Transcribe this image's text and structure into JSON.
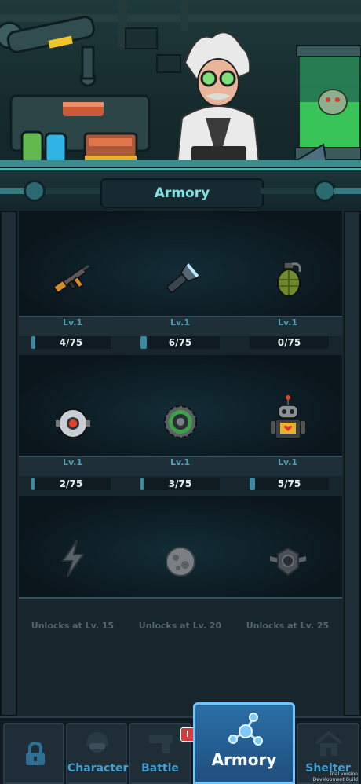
{
  "title": "Armory",
  "shelves": [
    {
      "items": [
        {
          "icon": "rifle-icon",
          "level": "Lv.1",
          "progress": "4/75",
          "fill": 0.05
        },
        {
          "icon": "flashlight-icon",
          "level": "Lv.1",
          "progress": "6/75",
          "fill": 0.08
        },
        {
          "icon": "grenade-icon",
          "level": "Lv.1",
          "progress": "0/75",
          "fill": 0
        }
      ]
    },
    {
      "items": [
        {
          "icon": "drone-orb-icon",
          "level": "Lv.1",
          "progress": "2/75",
          "fill": 0.03
        },
        {
          "icon": "sawblade-icon",
          "level": "Lv.1",
          "progress": "3/75",
          "fill": 0.04
        },
        {
          "icon": "robot-icon",
          "level": "Lv.1",
          "progress": "5/75",
          "fill": 0.07
        }
      ]
    },
    {
      "items": [
        {
          "icon": "lightning-icon",
          "unlock": "Unlocks at Lv. 15"
        },
        {
          "icon": "asteroid-icon",
          "unlock": "Unlocks at Lv. 20"
        },
        {
          "icon": "shield-emblem-icon",
          "unlock": "Unlocks at Lv. 25"
        }
      ]
    }
  ],
  "nav": {
    "tabs": [
      {
        "label": "",
        "icon": "lock-icon"
      },
      {
        "label": "Character",
        "icon": "helmet-icon"
      },
      {
        "label": "Battle",
        "icon": "gun-icon",
        "badge": "!"
      },
      {
        "label": "Armory",
        "icon": "network-icon"
      },
      {
        "label": "Shelter",
        "icon": "house-icon"
      }
    ]
  },
  "watermark": {
    "line1": "Trial version",
    "line2": "Development Build"
  },
  "colors": {
    "accent": "#70c6ff",
    "title": "#7fe0e0",
    "progress": "#3a8aa0",
    "badge": "#d33b3b"
  }
}
